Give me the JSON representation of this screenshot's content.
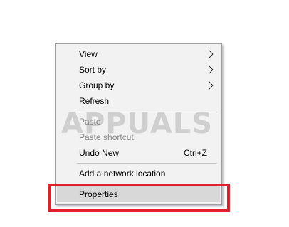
{
  "menu": {
    "items": {
      "view": {
        "label": "View",
        "submenu": true
      },
      "sort_by": {
        "label": "Sort by",
        "submenu": true
      },
      "group_by": {
        "label": "Group by",
        "submenu": true
      },
      "refresh": {
        "label": "Refresh"
      },
      "paste": {
        "label": "Paste",
        "disabled": true
      },
      "paste_shortcut": {
        "label": "Paste shortcut",
        "disabled": true
      },
      "undo_new": {
        "label": "Undo New",
        "shortcut": "Ctrl+Z"
      },
      "add_network_location": {
        "label": "Add a network location"
      },
      "properties": {
        "label": "Properties",
        "hovered": true
      }
    }
  },
  "watermark": {
    "text": "APPUALS"
  },
  "colors": {
    "menu_background": "#f2f2f2",
    "menu_border": "#a0a0a0",
    "hover_background": "#d8d8d8",
    "disabled_text": "#8a8a8a",
    "highlight_border": "#e0202b"
  },
  "icons": {
    "submenu_arrow": "chevron-right-icon"
  }
}
